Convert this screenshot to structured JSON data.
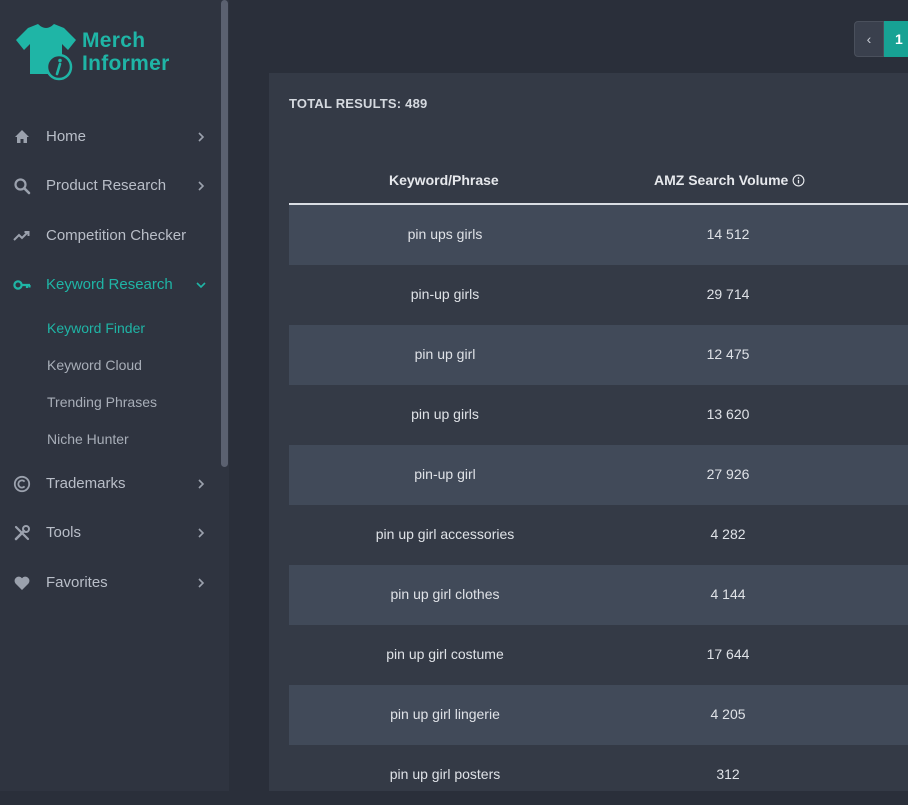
{
  "brand": {
    "line1": "Merch",
    "line2": "Informer",
    "accent_color": "#1fb5a6"
  },
  "sidebar": {
    "items": [
      {
        "label": "Home",
        "icon": "home-icon",
        "has_chevron": true
      },
      {
        "label": "Product Research",
        "icon": "search-icon",
        "has_chevron": true
      },
      {
        "label": "Competition Checker",
        "icon": "trend-icon",
        "has_chevron": false
      },
      {
        "label": "Keyword Research",
        "icon": "key-icon",
        "has_chevron": true,
        "expanded": true
      },
      {
        "label": "Trademarks",
        "icon": "copyright-icon",
        "has_chevron": true
      },
      {
        "label": "Tools",
        "icon": "tools-icon",
        "has_chevron": true
      },
      {
        "label": "Favorites",
        "icon": "heart-icon",
        "has_chevron": true
      }
    ],
    "subitems": [
      {
        "label": "Keyword Finder",
        "active": true
      },
      {
        "label": "Keyword Cloud"
      },
      {
        "label": "Trending Phrases"
      },
      {
        "label": "Niche Hunter"
      }
    ]
  },
  "pagination": {
    "prev": "‹",
    "current": "1"
  },
  "results": {
    "total_label": "TOTAL RESULTS: 489",
    "columns": [
      "Keyword/Phrase",
      "AMZ Search Volume"
    ],
    "info_icon": "info-icon",
    "rows": [
      {
        "keyword": "pin ups girls",
        "volume": "14 512"
      },
      {
        "keyword": "pin-up girls",
        "volume": "29 714"
      },
      {
        "keyword": "pin up girl",
        "volume": "12 475"
      },
      {
        "keyword": "pin up girls",
        "volume": "13 620"
      },
      {
        "keyword": "pin-up girl",
        "volume": "27 926"
      },
      {
        "keyword": "pin up girl accessories",
        "volume": "4 282"
      },
      {
        "keyword": "pin up girl clothes",
        "volume": "4 144"
      },
      {
        "keyword": "pin up girl costume",
        "volume": "17 644"
      },
      {
        "keyword": "pin up girl lingerie",
        "volume": "4 205"
      },
      {
        "keyword": "pin up girl posters",
        "volume": "312"
      }
    ]
  }
}
